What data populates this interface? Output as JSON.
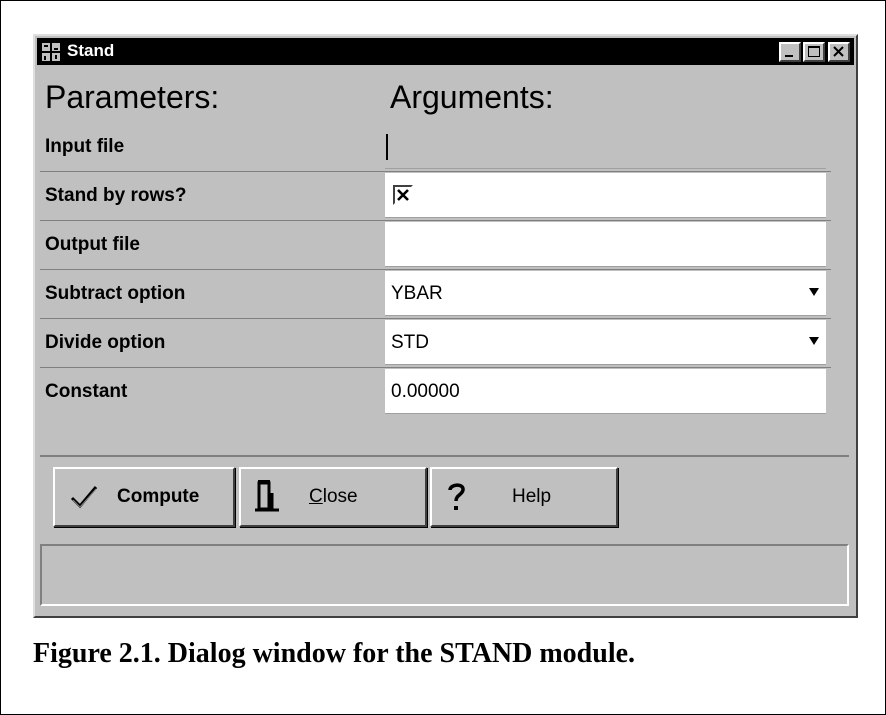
{
  "window": {
    "title": "Stand"
  },
  "grid": {
    "header_parameters": "Parameters:",
    "header_arguments": "Arguments:",
    "rows": [
      {
        "label": "Input file",
        "value": ""
      },
      {
        "label": "Stand by rows?",
        "value": ""
      },
      {
        "label": "Output file",
        "value": ""
      },
      {
        "label": "Subtract option",
        "value": "YBAR"
      },
      {
        "label": "Divide option",
        "value": "STD"
      },
      {
        "label": "Constant",
        "value": "0.00000"
      }
    ]
  },
  "buttons": {
    "compute": "Compute",
    "close": "Close",
    "help": "Help"
  },
  "status": {
    "text": ""
  },
  "caption": "Figure 2.1. Dialog window for the STAND module.",
  "checkbox_checked": true
}
